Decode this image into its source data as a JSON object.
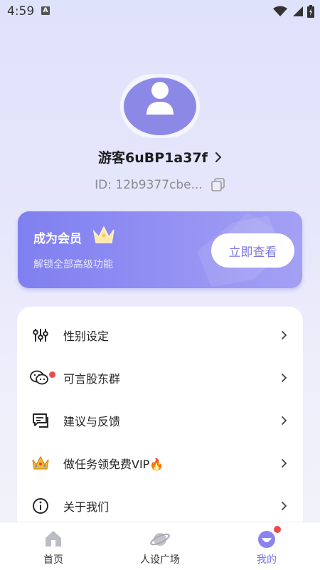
{
  "status_bar": {
    "time": "4:59",
    "notification_badge": "A",
    "icons": [
      "wifi-icon",
      "signal-icon",
      "battery-icon"
    ]
  },
  "profile": {
    "username": "游客6uBP1a37f",
    "id_text": "ID: 12b9377cbe..."
  },
  "vip_card": {
    "title": "成为会员",
    "subtitle": "解锁全部高级功能",
    "button_label": "立即查看"
  },
  "menu": {
    "items": [
      {
        "label": "性别设定",
        "icon": "sliders-icon"
      },
      {
        "label": "可言股东群",
        "icon": "wechat-icon"
      },
      {
        "label": "建议与反馈",
        "icon": "feedback-icon"
      },
      {
        "label": "做任务领免费VIP🔥",
        "icon": "crown-icon"
      },
      {
        "label": "关于我们",
        "icon": "info-icon"
      }
    ]
  },
  "bottom_nav": {
    "items": [
      {
        "label": "首页",
        "icon": "home-icon",
        "active": false
      },
      {
        "label": "人设广场",
        "icon": "planet-icon",
        "active": false
      },
      {
        "label": "我的",
        "icon": "profile-icon",
        "active": true
      }
    ]
  },
  "colors": {
    "accent": "#7b73e8",
    "vip_gradient_start": "#7f7ff0",
    "badge_red": "#ee4a4a"
  }
}
